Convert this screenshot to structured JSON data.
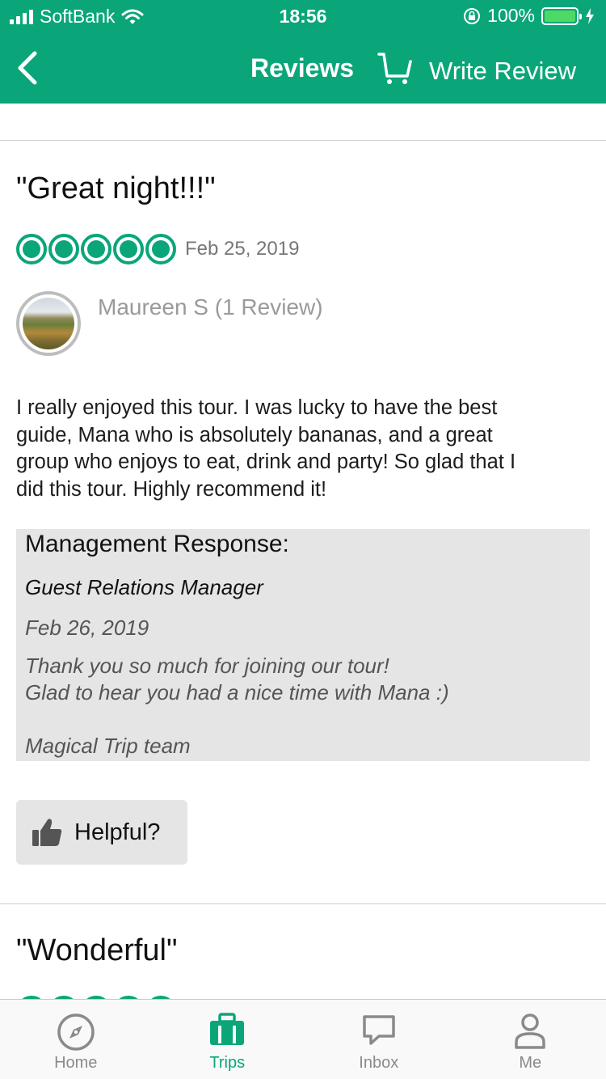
{
  "status_bar": {
    "carrier": "SoftBank",
    "time": "18:56",
    "battery": "100%"
  },
  "nav": {
    "title": "Reviews",
    "write_review": "Write Review"
  },
  "reviews": [
    {
      "title": "\"Great night!!!\"",
      "rating_bubbles": 5,
      "date": "Feb 25, 2019",
      "author": "Maureen S (1 Review)",
      "body_lines": [
        "I really enjoyed this tour. I was lucky to have the best",
        "guide, Mana who is absolutely bananas, and a great",
        "group who enjoys to eat, drink and party! So glad that I",
        "did this tour. Highly recommend it!"
      ],
      "management": {
        "heading": "Management Response:",
        "responder": "Guest Relations Manager",
        "date": "Feb 26, 2019",
        "reply_lines": [
          "Thank you so much for joining our tour!",
          "Glad to hear you had a nice time with Mana :)",
          "",
          "Magical Trip team"
        ]
      },
      "helpful_label": "Helpful?"
    },
    {
      "title": "\"Wonderful\"",
      "rating_bubbles": 5
    }
  ],
  "tabbar": {
    "items": [
      {
        "label": "Home",
        "icon": "compass-icon",
        "active": false
      },
      {
        "label": "Trips",
        "icon": "suitcase-icon",
        "active": true
      },
      {
        "label": "Inbox",
        "icon": "chat-bubble-icon",
        "active": false
      },
      {
        "label": "Me",
        "icon": "person-icon",
        "active": false
      }
    ]
  },
  "colors": {
    "brand": "#0aa67a",
    "battery_fill": "#4cd964",
    "response_background": "#e5e5e5"
  }
}
